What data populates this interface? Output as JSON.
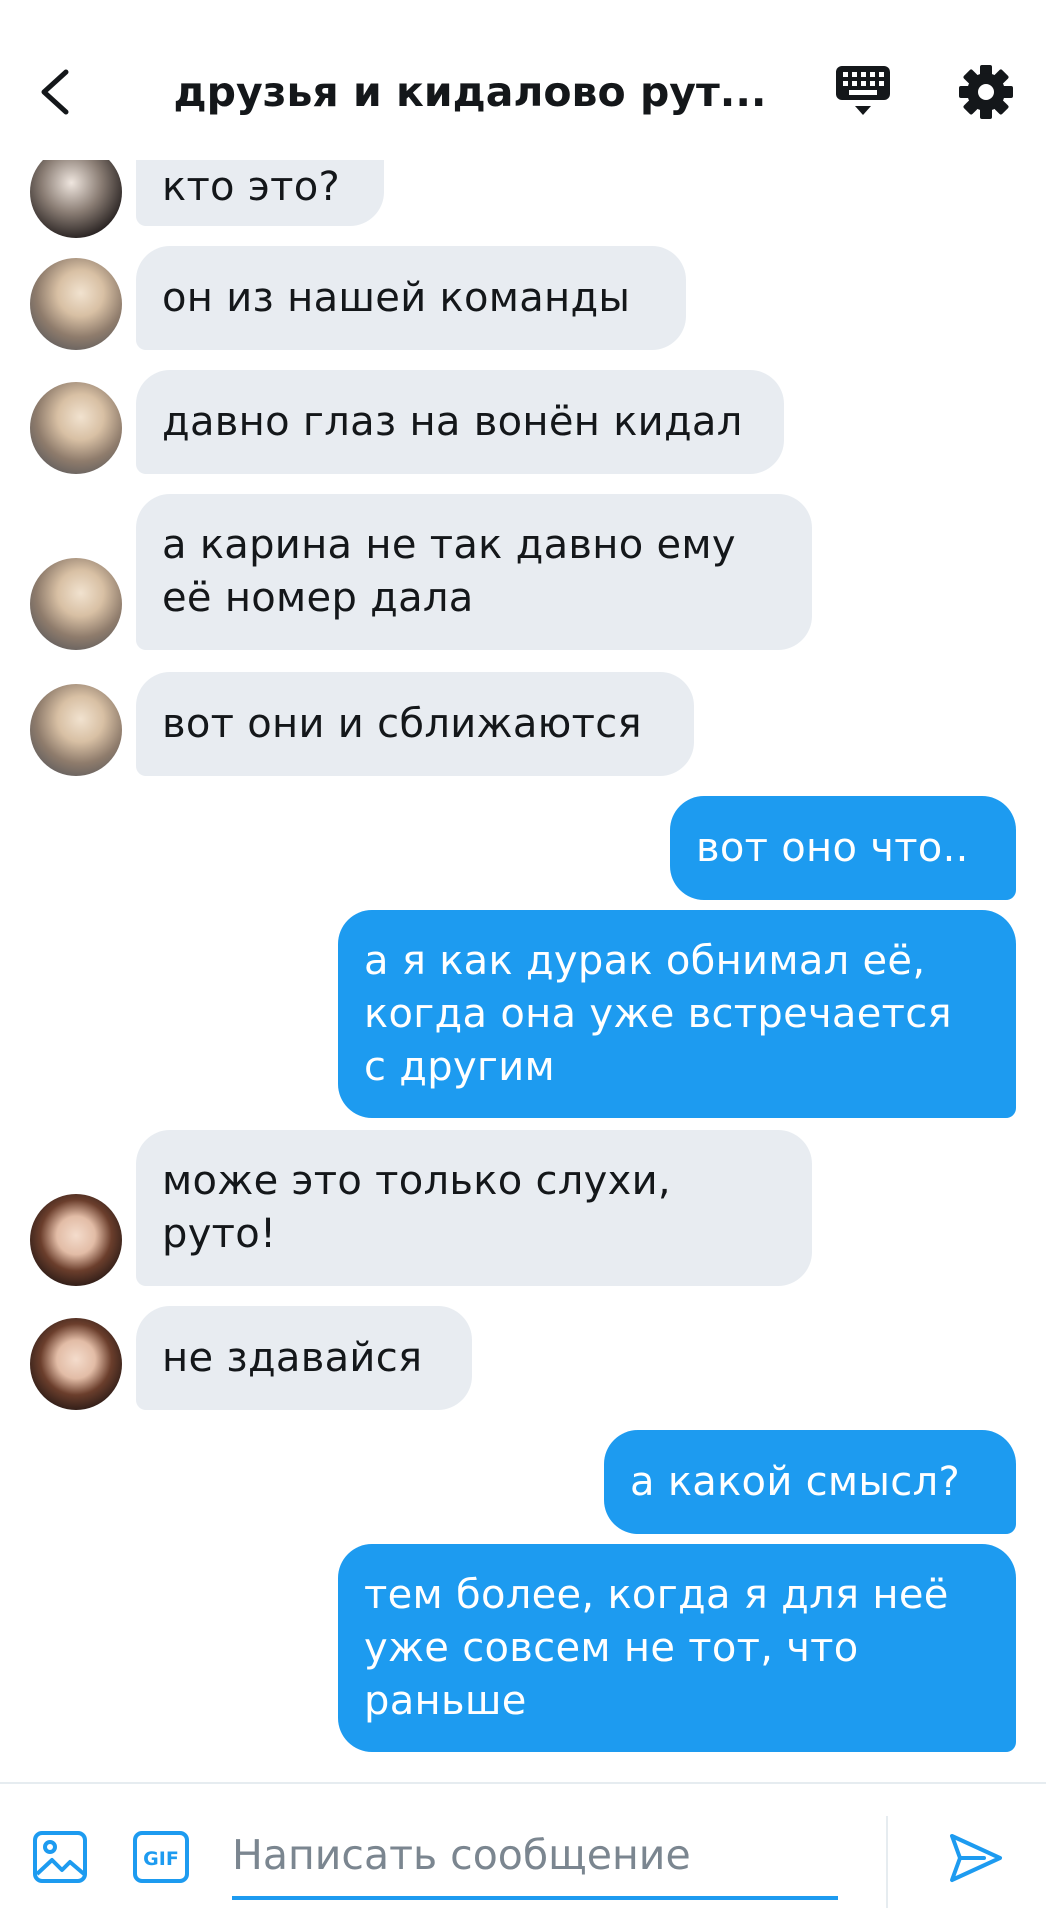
{
  "header": {
    "title": "друзья и кидалово рут...",
    "back_icon": "chevron-left-icon",
    "keyboard_icon": "keyboard-icon",
    "settings_icon": "gear-icon"
  },
  "messages": [
    {
      "side": "in",
      "avatar": "photo",
      "text": "кто это?"
    },
    {
      "side": "in",
      "avatar": "photo",
      "text": "он из нашей команды"
    },
    {
      "side": "in",
      "avatar": "photo",
      "text": "давно глаз на вонён кидал"
    },
    {
      "side": "in",
      "avatar": "photo",
      "text": "а карина не так давно ему\nеё номер дала"
    },
    {
      "side": "in",
      "avatar": "photo",
      "text": "вот они и сближаются"
    },
    {
      "side": "out",
      "text": "вот оно что.."
    },
    {
      "side": "out",
      "text": "а я как дурак обнимал её,\nкогда она уже встречается\nс другим"
    },
    {
      "side": "in",
      "avatar": "photo",
      "text": "може это только слухи,\nруто!"
    },
    {
      "side": "in",
      "avatar": "photo",
      "text": "не здавайся"
    },
    {
      "side": "out",
      "text": "а какой смысл?"
    },
    {
      "side": "out",
      "text": "тем более, когда я для неё\nуже совсем не тот, что\nраньше"
    }
  ],
  "composer": {
    "placeholder": "Написать сообщение",
    "image_icon": "image-icon",
    "gif_label": "GIF",
    "send_icon": "send-icon"
  },
  "colors": {
    "accent": "#1d9bf0",
    "incoming_bubble": "#e8ecf1",
    "text": "#14171a",
    "placeholder": "#7b8690"
  }
}
